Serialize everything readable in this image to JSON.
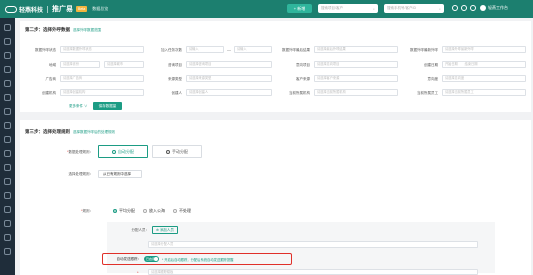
{
  "header": {
    "brand": "轻燕科技",
    "product": "推广易",
    "badge": "Beta",
    "subtitle": "数据总览",
    "new_button": "+ 新增",
    "search1_placeholder": "搜索项目/客户",
    "search2_placeholder": "搜索手机号/客户ID",
    "user": "轻燕工作台"
  },
  "step2": {
    "title": "第二步：选择外呼数据",
    "note": "选择外呼数据范围",
    "fields": [
      {
        "label": "数据外呼状态",
        "placeholder": "请选择数据外呼状态"
      },
      {
        "label": "加入任务次数",
        "placeholder_from": "请输入",
        "placeholder_to": "请输入"
      },
      {
        "label": "数据外呼最后结果",
        "placeholder": "请选择最后外呼结果"
      },
      {
        "label": "数据外呼最新外呼",
        "placeholder": "请选择外呼最新外呼"
      },
      {
        "label": "地域",
        "placeholder": "请选择省份",
        "placeholder2": "请选择城市"
      },
      {
        "label": "咨询项目",
        "placeholder": "请选择咨询项目"
      },
      {
        "label": "意向项目",
        "placeholder": "请选择意向项目"
      },
      {
        "label": "创建日期",
        "placeholder": "开始日期",
        "placeholder2": "结束日期"
      },
      {
        "label": "广告商",
        "placeholder": "请选择广告商"
      },
      {
        "label": "来源类型",
        "placeholder": "请选择来源类型"
      },
      {
        "label": "客户来源",
        "placeholder": "请选择客户来源"
      },
      {
        "label": "意向度",
        "placeholder": "请选择意向度"
      },
      {
        "label": "创建机构",
        "placeholder": "请选择创建机构"
      },
      {
        "label": "创建人",
        "placeholder": "请选择创建人"
      },
      {
        "label": "当前所属机构",
        "placeholder": "请选择当前所属机构"
      },
      {
        "label": "当前所属员工",
        "placeholder": "请选择当前所属员工"
      }
    ],
    "collapse": "更多条件 ∨",
    "save_button": "保存数据量"
  },
  "step3": {
    "title": "第三步：选择处理规则",
    "note": "选择数据外呼后的处理规则",
    "data_rule_label": "数据处理规则：",
    "option_auto": "自动分配",
    "option_manual": "手动分配",
    "choose_rule_label": "选择处理规则：",
    "choose_rule_button": "从已有规则中选择",
    "rule_label": "规则：",
    "radios": [
      "平均分配",
      "放入公海",
      "不处理"
    ],
    "assignee_label": "分配人员：",
    "add_person": "添加人员",
    "assignee_placeholder": "请选择分配人员",
    "auto_track_label": "自动发送跟踪：",
    "toggle_text": "已启用",
    "toggle_hint": "* 开启后自动跟踪，分配后系统自动发送跟踪提醒",
    "template_placeholder": "请选择跟踪模板"
  }
}
